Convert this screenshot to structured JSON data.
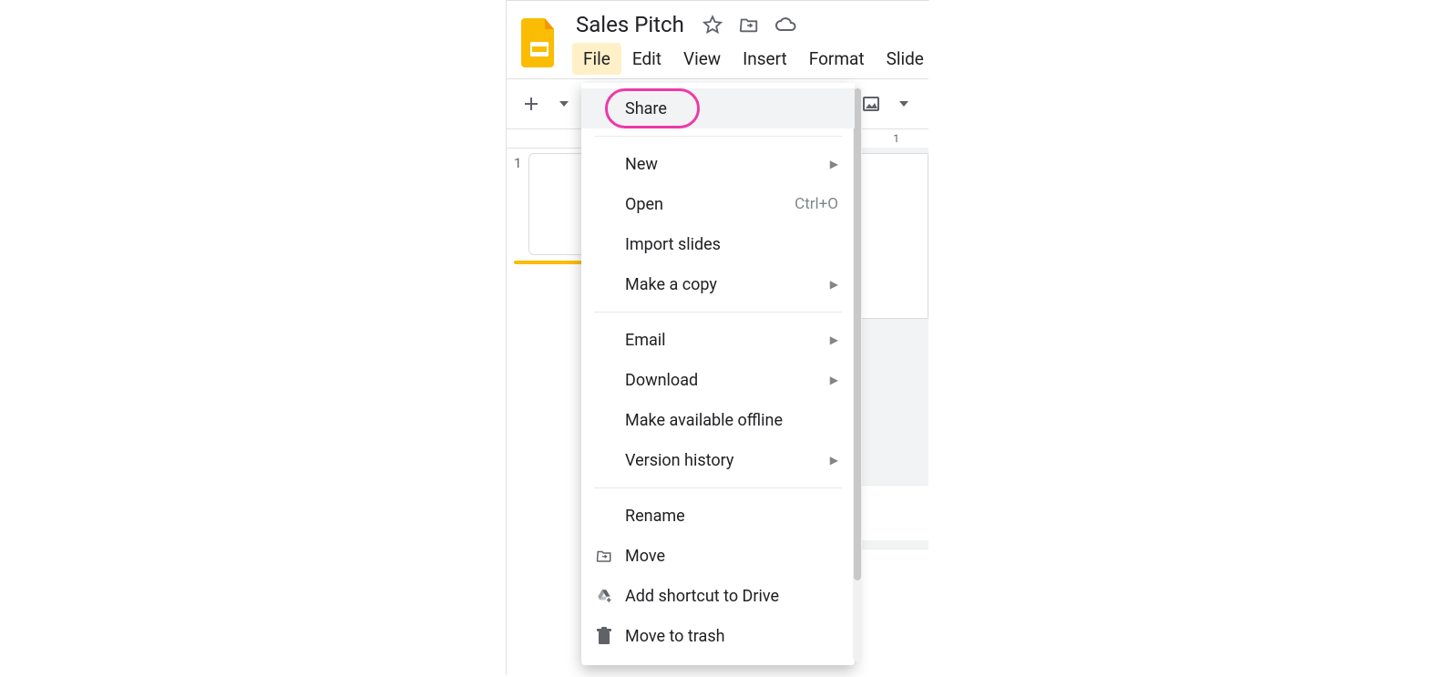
{
  "doc": {
    "title": "Sales Pitch"
  },
  "menubar": {
    "items": [
      "File",
      "Edit",
      "View",
      "Insert",
      "Format",
      "Slide"
    ],
    "active_index": 0
  },
  "filemenu": {
    "share": {
      "label": "Share"
    },
    "new": {
      "label": "New"
    },
    "open": {
      "label": "Open",
      "shortcut": "Ctrl+O"
    },
    "import": {
      "label": "Import slides"
    },
    "copy": {
      "label": "Make a copy"
    },
    "email": {
      "label": "Email"
    },
    "download": {
      "label": "Download"
    },
    "offline": {
      "label": "Make available offline"
    },
    "history": {
      "label": "Version history"
    },
    "rename": {
      "label": "Rename"
    },
    "move": {
      "label": "Move"
    },
    "shortcut": {
      "label": "Add shortcut to Drive"
    },
    "trash": {
      "label": "Move to trash"
    }
  },
  "slides": {
    "current_number": "1"
  },
  "ruler": {
    "label": "1"
  }
}
